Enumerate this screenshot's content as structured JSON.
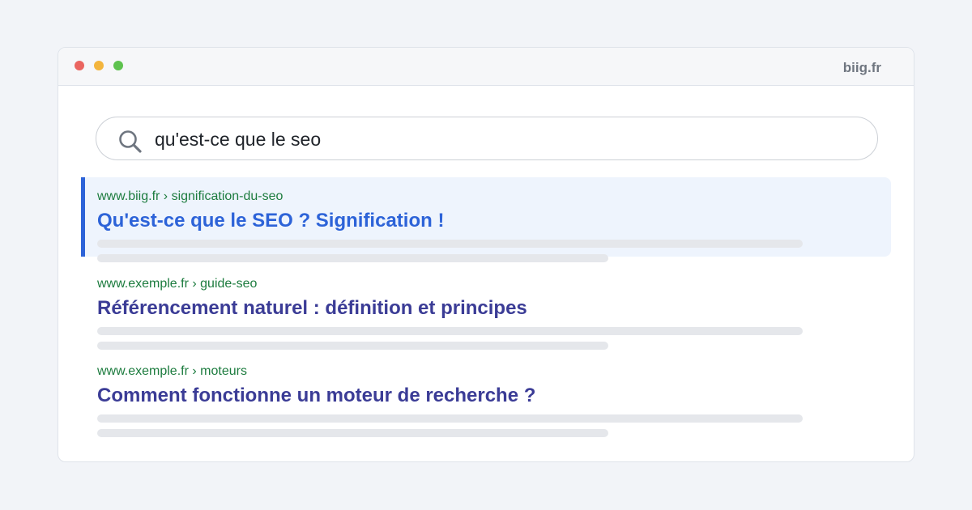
{
  "window": {
    "site_label": "biig.fr"
  },
  "search": {
    "query": "qu'est-ce que le seo"
  },
  "results": [
    {
      "url": "www.biig.fr › signification-du-seo",
      "title": "Qu'est-ce que le SEO ? Signification !",
      "highlighted": true
    },
    {
      "url": "www.exemple.fr › guide-seo",
      "title": "Référencement naturel : définition et principes",
      "highlighted": false
    },
    {
      "url": "www.exemple.fr › moteurs",
      "title": "Comment fonctionne un moteur de recherche ?",
      "highlighted": false
    }
  ],
  "icons": {
    "search": "search-icon",
    "window_controls": [
      "close-dot",
      "minimize-dot",
      "maximize-dot"
    ]
  },
  "colors": {
    "accent": "#2d63d8",
    "url_green": "#1d7c3f",
    "title_purple": "#3b3c96",
    "highlight_bg": "#eef4fd"
  }
}
